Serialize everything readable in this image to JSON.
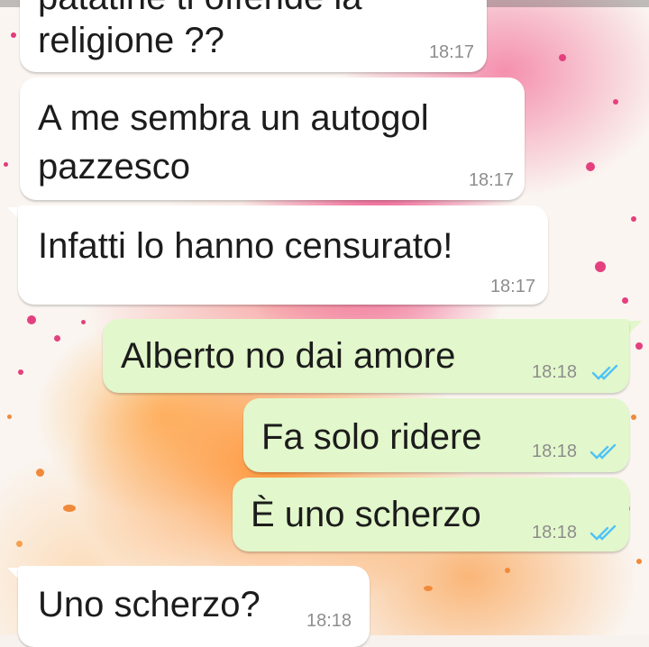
{
  "messages": [
    {
      "text_line1": "patatine ti offende la",
      "text_line2": "religione ??",
      "time": "18:17",
      "direction": "incoming"
    },
    {
      "text_line1": "A me sembra un autogol",
      "text_line2": "pazzesco",
      "time": "18:17",
      "direction": "incoming"
    },
    {
      "text": "Infatti lo hanno censurato!",
      "time": "18:17",
      "direction": "incoming"
    },
    {
      "text": "Alberto no dai amore",
      "time": "18:18",
      "direction": "outgoing",
      "status": "read"
    },
    {
      "text": "Fa solo ridere",
      "time": "18:18",
      "direction": "outgoing",
      "status": "read"
    },
    {
      "text": "È uno scherzo",
      "time": "18:18",
      "direction": "outgoing",
      "status": "read"
    },
    {
      "text": "Uno scherzo?",
      "time": "18:18",
      "direction": "incoming"
    }
  ],
  "icons": {
    "read_receipt": "double-check-icon"
  },
  "colors": {
    "incoming_bubble": "#ffffff",
    "outgoing_bubble": "#e2f7cb",
    "read_tick": "#4fc3f7"
  }
}
